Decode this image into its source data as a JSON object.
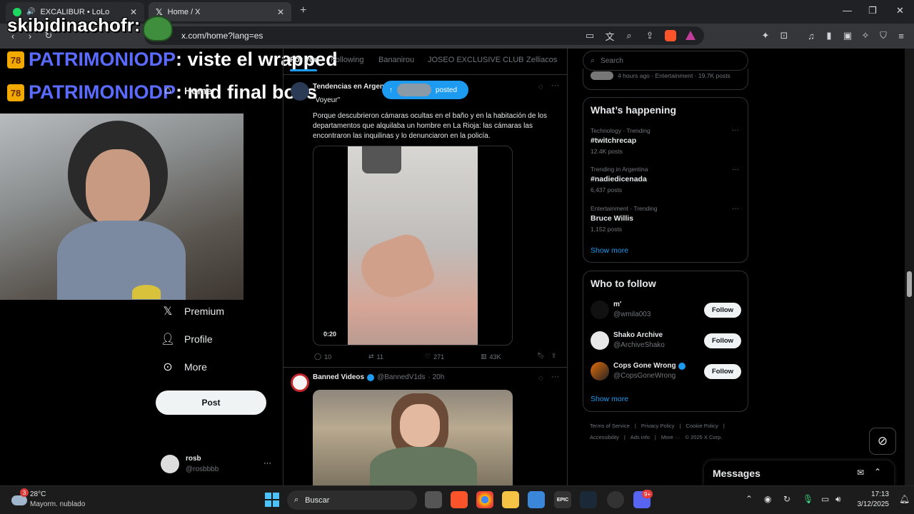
{
  "browser": {
    "tabs": [
      {
        "label": "EXCALIBUR • LoLo"
      },
      {
        "label": "Home / X"
      }
    ],
    "url": "x.com/home?lang=es",
    "new_tab": "+"
  },
  "stream_overlay": {
    "streamer": "skibidinachofr:",
    "chat": [
      {
        "user": "PATRIMONIODP",
        "message": ": viste el wrapped"
      },
      {
        "user": "PATRIMONIODP",
        "message": ": mid final boss"
      }
    ]
  },
  "left_nav": {
    "items": [
      {
        "label": "Home",
        "icon": "home-icon"
      },
      {
        "label": "Premium",
        "icon": "x-logo-icon"
      },
      {
        "label": "Profile",
        "icon": "person-icon"
      },
      {
        "label": "More",
        "icon": "more-circle-icon"
      }
    ],
    "post_button": "Post",
    "account": {
      "name": "rosb",
      "handle": "@rosbbbb",
      "menu": "···"
    }
  },
  "feed": {
    "tabs": [
      "For you",
      "Following",
      "Bananirou",
      "JOSEO EXCLUSIVE CLUB",
      "Zelliacos"
    ],
    "posted_pill": "posted",
    "tweet1": {
      "author": "Tendencias en Argen",
      "quote": "\"Voyeur\"",
      "text": "Porque descubrieron cámaras ocultas en el baño y en la habitación de los departamentos que alquilaba un hombre en La Rioja: las cámaras las encontraron las inquilinas y lo denunciaron en la policía.",
      "video_time": "0:20",
      "replies": "10",
      "reposts": "11",
      "likes": "271",
      "views": "43K"
    },
    "tweet2": {
      "author": "Banned Videos",
      "handle": "@BannedV1ds",
      "time": "· 20h"
    }
  },
  "right": {
    "search_placeholder": "Search",
    "prev_trend_meta": "4 hours ago · Entertainment · 19.7K posts",
    "whats_happening": {
      "title": "What’s happening",
      "trends": [
        {
          "category": "Technology · Trending",
          "name": "#twitchrecap",
          "count": "12.4K posts"
        },
        {
          "category": "Trending in Argentina",
          "name": "#nadiedicenada",
          "count": "6,437 posts"
        },
        {
          "category": "Entertainment · Trending",
          "name": "Bruce Willis",
          "count": "1,152 posts"
        }
      ],
      "show_more": "Show more"
    },
    "who_to_follow": {
      "title": "Who to follow",
      "accounts": [
        {
          "name": "m'",
          "handle": "@wmila003",
          "button": "Follow"
        },
        {
          "name": "Shako Archive",
          "handle": "@ArchiveShako",
          "button": "Follow"
        },
        {
          "name": "Cops Gone Wrong",
          "handle": "@CopsGoneWrong",
          "button": "Follow"
        }
      ],
      "show_more": "Show more"
    },
    "footer": [
      "Terms of Service",
      "|",
      "Privacy Policy",
      "|",
      "Cookie Policy",
      "|",
      "Accessibility",
      "|",
      "Ads info",
      "|",
      "More ···",
      "© 2025 X Corp."
    ],
    "messages": "Messages"
  },
  "taskbar": {
    "weather_temp": "28°C",
    "weather_desc": "Mayorm. nublado",
    "weather_badge": "3",
    "search": "Buscar",
    "time": "17:13",
    "date": "3/12/2025",
    "discord_badge": "9+"
  },
  "colors": {
    "accent": "#1d9bf0",
    "brave": "#fb542b",
    "verified": "#1d9bf0"
  }
}
